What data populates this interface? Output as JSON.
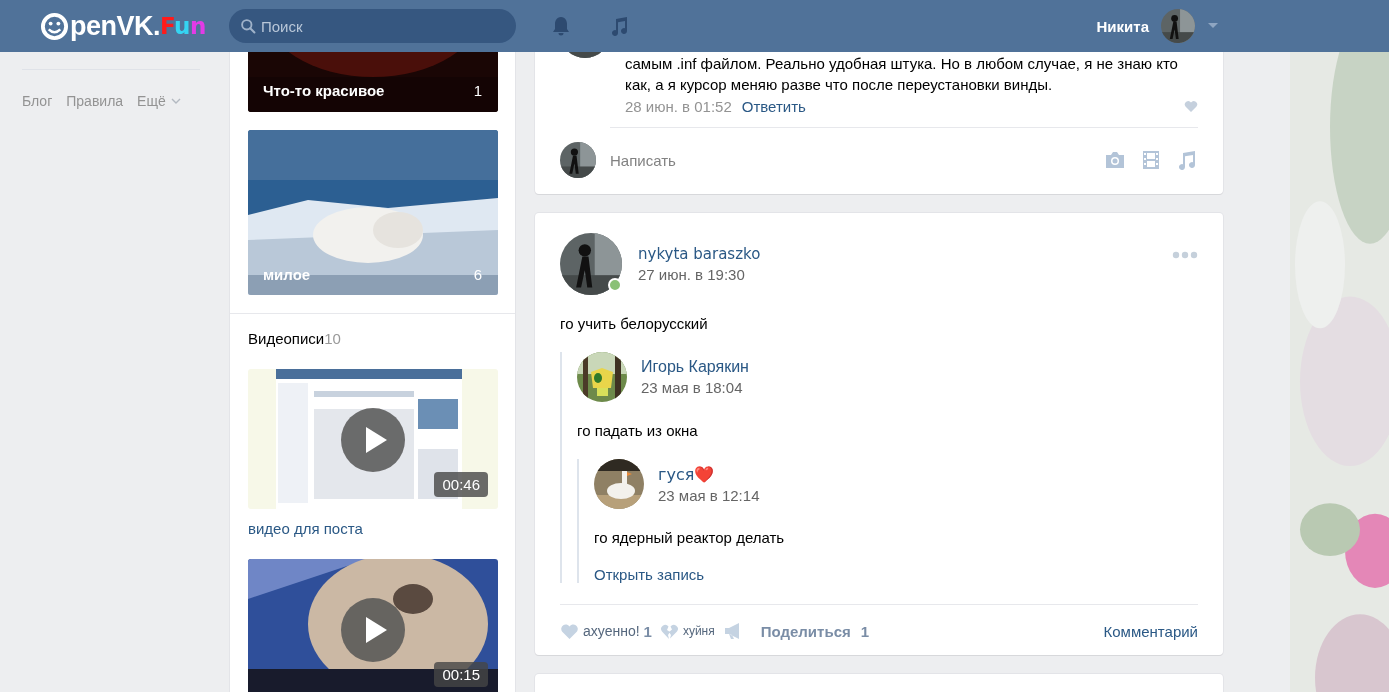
{
  "header": {
    "logo": {
      "text": "penVK.",
      "accent": "Fun"
    },
    "search": {
      "placeholder": "Поиск"
    },
    "user": {
      "name": "Никита"
    }
  },
  "sidebar": {
    "links": [
      {
        "label": "Блог",
        "kind": "link"
      },
      {
        "label": "Правила",
        "kind": "link"
      },
      {
        "label": "Ещё",
        "kind": "menu"
      }
    ]
  },
  "albums": [
    {
      "title": "Что-то красивое",
      "count": "1",
      "kind": "dark"
    },
    {
      "title": "милое",
      "count": "6",
      "kind": "snow"
    }
  ],
  "videos": {
    "heading": "Видеописи",
    "count": "10",
    "items": [
      {
        "duration": "00:46",
        "title": "видео для поста",
        "kind": "screen"
      },
      {
        "duration": "00:15",
        "kind": "pet"
      }
    ]
  },
  "feed": {
    "comment": {
      "text": "самым .inf файлом. Реально удобная штука. Но в любом случае, я не знаю кто как, а я курсор меняю разве что после переустановки винды.",
      "date": "28 июн. в 01:52",
      "reply": "Ответить",
      "liked": false
    },
    "compose": {
      "placeholder": "Написать"
    },
    "post": {
      "author": "nykyta baraszko",
      "online": true,
      "date": "27 июн. в 19:30",
      "text": "го учить белорусский",
      "repost": {
        "author": "Игорь Карякин",
        "date": "23 мая в 18:04",
        "text": "го падать из окна",
        "repost": {
          "author": "гуся❤️",
          "date": "23 мая в 12:14",
          "text": "го ядерный реактор делать",
          "open_link": "Открыть запись"
        }
      },
      "reactions": [
        {
          "label": "ахуенно!",
          "count": "1",
          "kind": "like"
        },
        {
          "label": "хуйня",
          "kind": "dislike"
        }
      ],
      "share": {
        "label": "Поделиться",
        "count": "1"
      },
      "comment_link": "Комментарий"
    }
  }
}
